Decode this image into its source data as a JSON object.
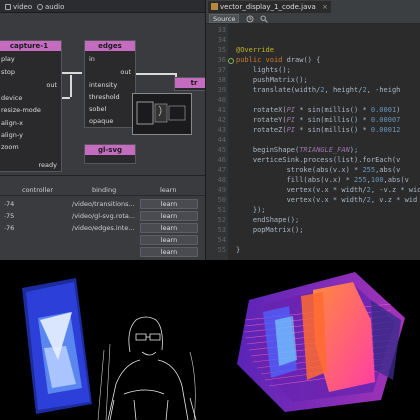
{
  "node_pane": {
    "tabs": [
      {
        "label": "video",
        "icon": "video-icon"
      },
      {
        "label": "audio",
        "icon": "audio-icon"
      }
    ],
    "nodes": {
      "capture": {
        "title": "capture-1",
        "params": [
          "play",
          "stop",
          "device",
          "resize-mode",
          "align-x",
          "align-y",
          "zoom"
        ],
        "out": "out",
        "ready": "ready"
      },
      "edges": {
        "title": "edges",
        "in": "in",
        "out": "out",
        "params": [
          "intensity",
          "threshold",
          "sobel",
          "opaque"
        ]
      },
      "gl_svg": {
        "title": "gl-svg"
      },
      "partial": {
        "title": "tr"
      }
    }
  },
  "midi_table": {
    "columns": [
      "controller",
      "binding",
      "learn"
    ],
    "rows": [
      {
        "controller": "74",
        "binding": "/video/transitions...",
        "learn": "learn"
      },
      {
        "controller": "75",
        "binding": "/video/gl-svg.rota...",
        "learn": "learn"
      },
      {
        "controller": "76",
        "binding": "/video/edges.inte...",
        "learn": "learn"
      },
      {
        "controller": "",
        "binding": "",
        "learn": "learn"
      },
      {
        "controller": "",
        "binding": "",
        "learn": "learn"
      }
    ]
  },
  "editor": {
    "tab_label": "vector_display_1_code.java",
    "source_button": "Source",
    "lines": [
      {
        "n": "33",
        "code": ""
      },
      {
        "n": "34",
        "code": ""
      },
      {
        "n": "35",
        "code": "@Override"
      },
      {
        "n": "36",
        "code": "public void draw() {"
      },
      {
        "n": "37",
        "code": "    lights();"
      },
      {
        "n": "38",
        "code": "    pushMatrix();"
      },
      {
        "n": "39",
        "code": "    translate(width/2, height/2, -heigh"
      },
      {
        "n": "40",
        "code": ""
      },
      {
        "n": "41",
        "code": "    rotateX(PI * sin(millis() * 0.0001)"
      },
      {
        "n": "42",
        "code": "    rotateY(PI * sin(millis() * 0.00007"
      },
      {
        "n": "43",
        "code": "    rotateZ(PI * sin(millis() * 0.00012"
      },
      {
        "n": "44",
        "code": ""
      },
      {
        "n": "45",
        "code": "    beginShape(TRIANGLE_FAN);"
      },
      {
        "n": "46",
        "code": "    verticeSink.process(list).forEach(v"
      },
      {
        "n": "47",
        "code": "            stroke(abs(v.x) * 255,abs(v"
      },
      {
        "n": "48",
        "code": "            fill(abs(v.x) * 255,100,abs(v"
      },
      {
        "n": "49",
        "code": "            vertex(v.x * width/2, -v.z * wid"
      },
      {
        "n": "50",
        "code": "            vertex(v.x * width/2, v.z * wid"
      },
      {
        "n": "51",
        "code": "    });"
      },
      {
        "n": "52",
        "code": "    endShape();"
      },
      {
        "n": "53",
        "code": "    popMatrix();"
      },
      {
        "n": "54",
        "code": ""
      },
      {
        "n": "55",
        "code": "}"
      }
    ]
  },
  "colors": {
    "node_title_accent": "#c56cc0",
    "editor_bg": "#2b2b2b",
    "keyword": "#cc7832",
    "annotation": "#bbb529"
  }
}
